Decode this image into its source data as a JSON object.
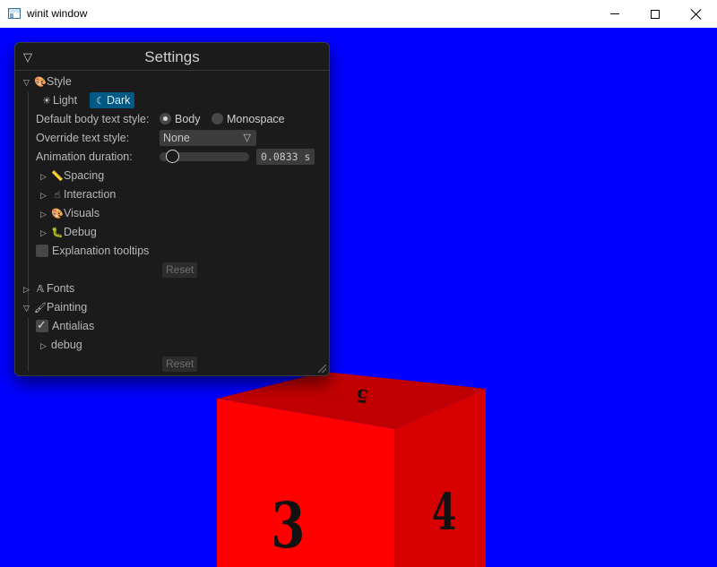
{
  "window": {
    "title": "winit window"
  },
  "settings": {
    "title": "Settings",
    "style_header": "Style",
    "theme": {
      "light_label": "Light",
      "dark_label": "Dark",
      "selected": "Dark"
    },
    "body_text_label": "Default body text style:",
    "body_opt": "Body",
    "mono_opt": "Monospace",
    "override_label": "Override text style:",
    "override_value": "None",
    "anim_label": "Animation duration:",
    "anim_value": "0.0833 s",
    "anim_fraction": 0.08,
    "spacing_label": "Spacing",
    "interaction_label": "Interaction",
    "visuals_label": "Visuals",
    "debug_label": "Debug",
    "tooltips_label": "Explanation tooltips",
    "tooltips_checked": false,
    "reset_label": "Reset",
    "fonts_label": "Fonts",
    "painting_label": "Painting",
    "antialias_label": "Antialias",
    "antialias_checked": true,
    "debug2_label": "debug",
    "reset2_label": "Reset"
  },
  "scene": {
    "background": "#0000ff",
    "cube_front_color": "#ff0000",
    "cube_side_color": "#d60000",
    "cube_top_color": "#c00000",
    "front_number": "3",
    "side_number": "4",
    "top_number": "5"
  }
}
